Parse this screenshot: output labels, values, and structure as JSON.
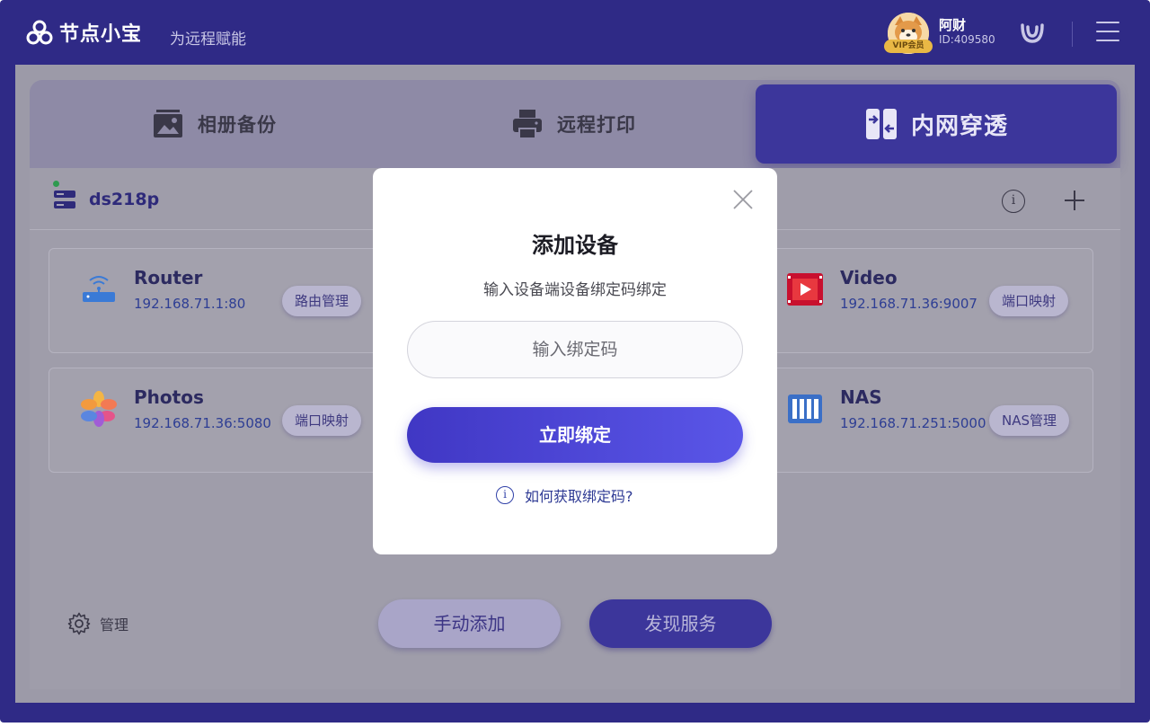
{
  "header": {
    "app_name": "节点小宝",
    "slogan": "为远程赋能",
    "user": {
      "name": "阿财",
      "id": "ID:409580",
      "vip": "VIP会员"
    }
  },
  "tabs": [
    {
      "label": "相册备份",
      "icon": "photo-album-icon",
      "active": false
    },
    {
      "label": "远程打印",
      "icon": "printer-icon",
      "active": false
    },
    {
      "label": "内网穿透",
      "icon": "network-tunnel-icon",
      "active": true
    }
  ],
  "device": {
    "name": "ds218p",
    "status": "online"
  },
  "services": [
    {
      "name": "Router",
      "address": "192.168.71.1:80",
      "action": "路由管理",
      "icon": "router-icon"
    },
    {
      "name": "Video",
      "address": "192.168.71.36:9007",
      "action": "端口映射",
      "icon": "video-icon"
    },
    {
      "name": "Photos",
      "address": "192.168.71.36:5080",
      "action": "端口映射",
      "icon": "photos-icon"
    },
    {
      "name": "NAS",
      "address": "192.168.71.251:5000",
      "action": "NAS管理",
      "icon": "nas-icon"
    }
  ],
  "footer": {
    "manage_label": "管理",
    "manual_add": "手动添加",
    "discover": "发现服务"
  },
  "modal": {
    "title": "添加设备",
    "subtitle": "输入设备端设备绑定码绑定",
    "input_placeholder": "输入绑定码",
    "input_value": "",
    "submit_label": "立即绑定",
    "help_label": "如何获取绑定码?"
  },
  "colors": {
    "brand": "#2f2a86",
    "accent": "#4a44d8",
    "active_tab": "#3c369b"
  }
}
